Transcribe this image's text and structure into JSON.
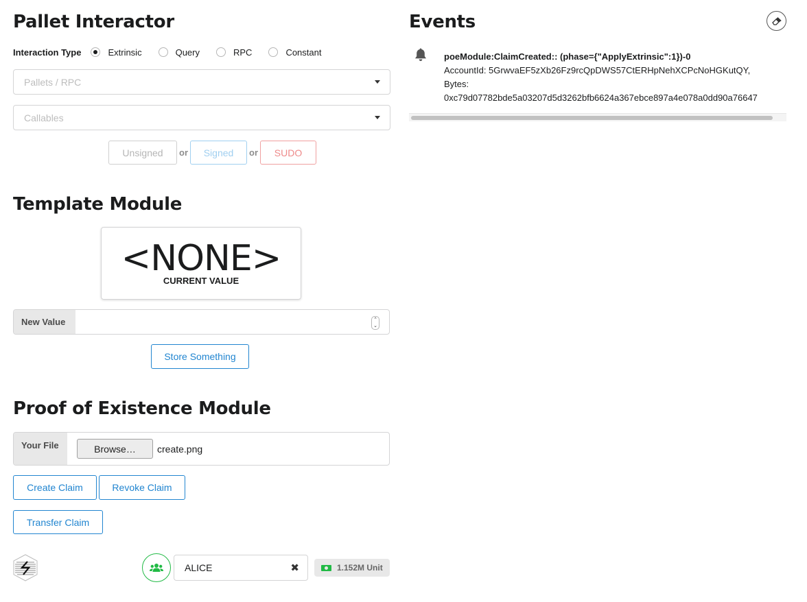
{
  "pallet": {
    "title": "Pallet Interactor",
    "interaction_label": "Interaction Type",
    "types": [
      "Extrinsic",
      "Query",
      "RPC",
      "Constant"
    ],
    "selected_type": "Extrinsic",
    "pallets_placeholder": "Pallets / RPC",
    "callables_placeholder": "Callables",
    "tx_buttons": {
      "unsigned": "Unsigned",
      "signed": "Signed",
      "sudo": "SUDO",
      "or": "or"
    }
  },
  "template": {
    "title": "Template Module",
    "current_value": "<NONE>",
    "current_value_caption": "CURRENT VALUE",
    "new_value_label": "New Value",
    "new_value": "",
    "store_button": "Store Something"
  },
  "poe": {
    "title": "Proof of Existence Module",
    "file_label": "Your File",
    "browse_label": "Browse…",
    "file_name": "create.png",
    "create_button": "Create Claim",
    "revoke_button": "Revoke Claim",
    "transfer_button": "Transfer Claim"
  },
  "events": {
    "title": "Events",
    "items": [
      {
        "title": "poeModule:ClaimCreated:: (phase={\"ApplyExtrinsic\":1})-0",
        "account": "AccountId: 5GrwvaEF5zXb26Fz9rcQpDWS57CtERHpNehXCPcNoHGKutQY,",
        "bytes_label": "Bytes:",
        "bytes": "0xc79d07782bde5a03207d5d3262bfb6624a367ebce897a4e078a0dd90a76647"
      }
    ]
  },
  "account": {
    "name": "ALICE",
    "balance": "1.152M Unit"
  },
  "icons": {
    "bell": "bell-icon",
    "eraser": "eraser-icon",
    "users": "users-icon",
    "close": "close-icon",
    "money": "money-icon",
    "logo": "substrate-logo"
  },
  "colors": {
    "primary": "#2185d0",
    "signed": "#a0cff0",
    "sudo": "#db2828",
    "accounts_green": "#21ba45"
  }
}
